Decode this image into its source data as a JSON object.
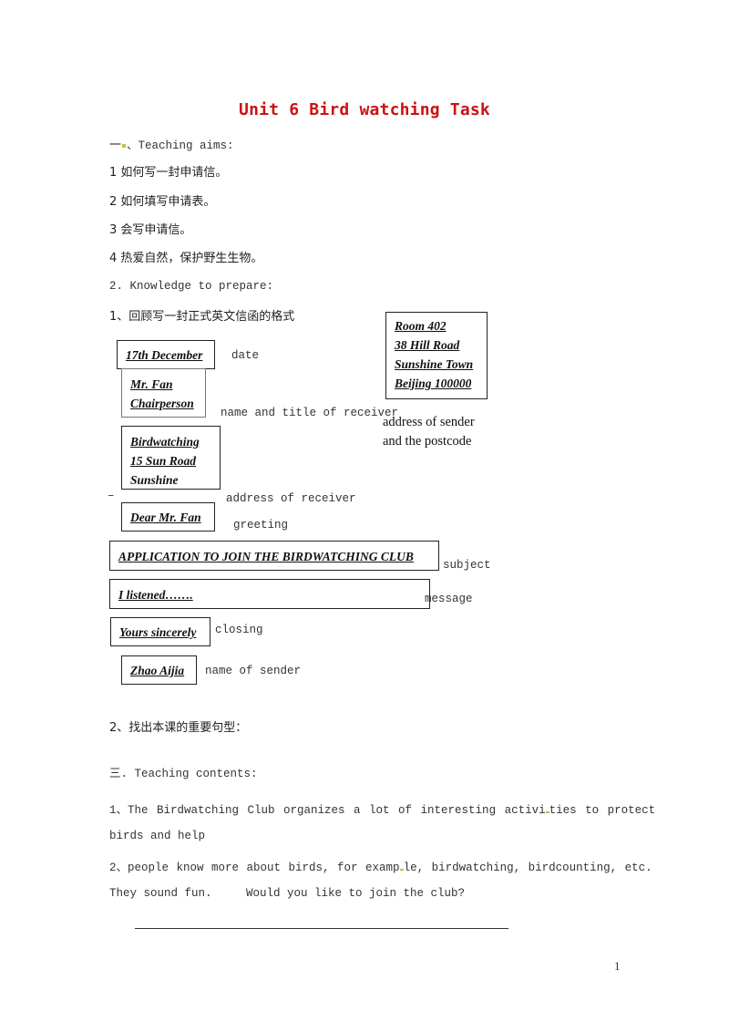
{
  "document": {
    "title": "Unit 6 Bird watching Task",
    "section1": {
      "heading_prefix": "一",
      "heading_text": "、Teaching aims:",
      "aims": [
        "1 如何写一封申请信。",
        "2 如何填写申请表。",
        "3 会写申请信。",
        "4 热爱自然，保护野生生物。"
      ]
    },
    "section2": {
      "heading": "2. Knowledge to prepare:",
      "item1": "1、回顾写一封正式英文信函的格式",
      "letter_format": {
        "sender_address": {
          "lines": [
            "Room 402",
            "38 Hill Road",
            "Sunshine Town",
            "Beijing 100000"
          ],
          "label_line1": "address of sender",
          "label_line2": "and the postcode"
        },
        "date": {
          "value": "17th December",
          "label": "date"
        },
        "receiver_name": {
          "lines": [
            "Mr. Fan",
            "Chairperson"
          ],
          "label": "name and title of receiver"
        },
        "receiver_address": {
          "lines": [
            "Birdwatching",
            "15 Sun Road",
            "Sunshine"
          ],
          "label": "address of receiver",
          "dash": "–"
        },
        "greeting": {
          "value": "Dear Mr. Fan",
          "label": "greeting"
        },
        "subject": {
          "value": "APPLICATION TO JOIN THE BIRDWATCHING CLUB",
          "label": "subject"
        },
        "message": {
          "value": "I listened…….",
          "label": "message"
        },
        "closing": {
          "value": "Yours sincerely",
          "label": "closing"
        },
        "sender_name": {
          "value": "Zhao Aijia",
          "label": "name of sender"
        }
      },
      "item2": "2、找出本课的重要句型："
    },
    "section3": {
      "heading": "三. Teaching contents:",
      "line1_a": "1、The Birdwatching Club organizes a lot of interesting activi",
      "line1_b": "ties to protect",
      "line2": "birds and help",
      "line3_a": "2、people know more about birds, for examp",
      "line3_b": "le, birdwatching, birdcounting, etc.",
      "line4": "They sound fun.     Would you like to join the club?"
    },
    "page_number": "1"
  },
  "colors": {
    "title": "#cc1111",
    "marker": "#c8c040"
  }
}
